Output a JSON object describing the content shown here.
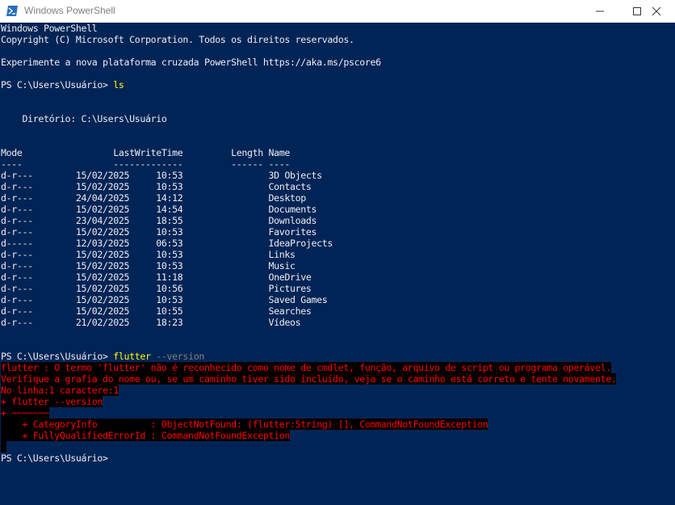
{
  "window": {
    "title": "Windows PowerShell",
    "minimize_icon": "minimize-icon",
    "maximize_icon": "maximize-icon",
    "close_icon": "close-icon",
    "app_icon": "powershell-icon"
  },
  "colors": {
    "background": "#012456",
    "foreground": "#eeedf0",
    "command": "#ffff00",
    "parameter": "#808080",
    "error_fg": "#ff0000",
    "error_bg": "#000000"
  },
  "console": {
    "banner": [
      "Windows PowerShell",
      "Copyright (C) Microsoft Corporation. Todos os direitos reservados.",
      "",
      "Experimente a nova plataforma cruzada PowerShell https://aka.ms/pscore6"
    ],
    "prompt1": "PS C:\\Users\\Usuário> ",
    "cmd1": "ls",
    "directory_line": "    Diretório: C:\\Users\\Usuário",
    "header": "Mode                 LastWriteTime         Length Name",
    "underline": "----                 -------------         ------ ----",
    "entries": [
      "d-r---        15/02/2025     10:53                3D Objects",
      "d-r---        15/02/2025     10:53                Contacts",
      "d-r---        24/04/2025     14:12                Desktop",
      "d-r---        15/02/2025     14:54                Documents",
      "d-r---        23/04/2025     18:55                Downloads",
      "d-r---        15/02/2025     10:53                Favorites",
      "d-----        12/03/2025     06:53                IdeaProjects",
      "d-r---        15/02/2025     10:53                Links",
      "d-r---        15/02/2025     10:53                Music",
      "d-r---        15/02/2025     11:18                OneDrive",
      "d-r---        15/02/2025     10:56                Pictures",
      "d-r---        15/02/2025     10:53                Saved Games",
      "d-r---        15/02/2025     10:55                Searches",
      "d-r---        21/02/2025     18:23                Vídeos"
    ],
    "prompt2": "PS C:\\Users\\Usuário> ",
    "cmd2": "flutter",
    "cmd2_param": " --version",
    "errors": [
      "flutter : O termo 'flutter' não é reconhecido como nome de cmdlet, função, arquivo de script ou programa operável.",
      "Verifique a grafia do nome ou, se um caminho tiver sido incluído, veja se o caminho está correto e tente novamente.",
      "No linha:1 caractere:1",
      "+ flutter --version",
      "+ ~~~~~~~",
      "    + CategoryInfo          : ObjectNotFound: (flutter:String) [], CommandNotFoundException",
      "    + FullyQualifiedErrorId : CommandNotFoundException"
    ],
    "prompt3": "PS C:\\Users\\Usuário>"
  }
}
